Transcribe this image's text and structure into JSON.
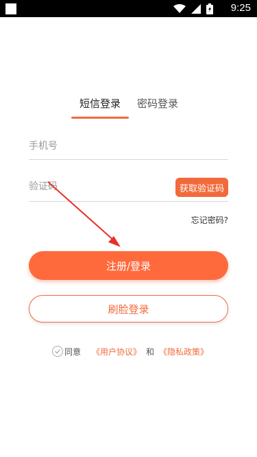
{
  "status_bar": {
    "time": "9:25",
    "icons": [
      "notification-icon",
      "wifi-icon",
      "signal-icon",
      "battery-icon"
    ]
  },
  "tabs": [
    {
      "label": "短信登录",
      "active": true
    },
    {
      "label": "密码登录",
      "active": false
    }
  ],
  "form": {
    "phone_placeholder": "手机号",
    "code_placeholder": "验证码",
    "get_code_label": "获取验证码",
    "forgot_label": "忘记密码?"
  },
  "buttons": {
    "register_login": "注册/登录",
    "face_login": "刷脸登录"
  },
  "agreement": {
    "agree": "同意",
    "user_agreement": "《用户协议》",
    "and": "和",
    "privacy_policy": "《隐私政策》"
  },
  "colors": {
    "accent": "#f26a3b",
    "primary_button": "#ff6a3d",
    "annotation_arrow": "#e8302a"
  }
}
